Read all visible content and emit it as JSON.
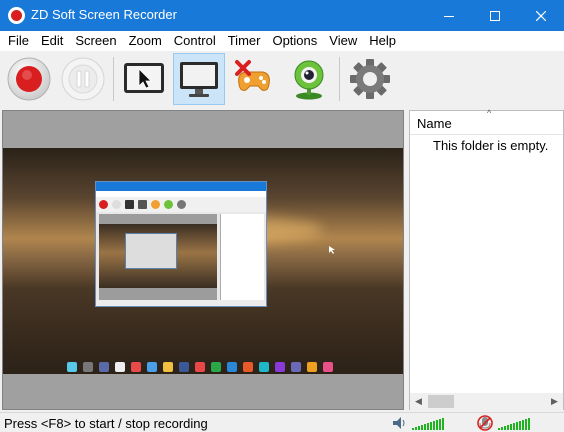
{
  "window": {
    "title": "ZD Soft Screen Recorder"
  },
  "menu": {
    "items": [
      "File",
      "Edit",
      "Screen",
      "Zoom",
      "Control",
      "Timer",
      "Options",
      "View",
      "Help"
    ]
  },
  "toolbar": {
    "buttons": [
      {
        "name": "record",
        "icon": "record-icon",
        "active": false
      },
      {
        "name": "pause",
        "icon": "pause-icon",
        "active": false
      },
      {
        "name": "select-region",
        "icon": "cursor-region-icon",
        "active": false
      },
      {
        "name": "full-screen",
        "icon": "monitor-icon",
        "active": true
      },
      {
        "name": "game-mode",
        "icon": "gamepad-icon",
        "active": false
      },
      {
        "name": "webcam",
        "icon": "webcam-icon",
        "active": false
      },
      {
        "name": "settings",
        "icon": "gear-icon",
        "active": false
      }
    ]
  },
  "file_panel": {
    "column_name": "Name",
    "empty_text": "This folder is empty."
  },
  "status": {
    "text": "Press <F8> to start / stop recording"
  },
  "colors": {
    "titlebar": "#1979d9",
    "record_red": "#d81e1e",
    "active_button": "#cce4f7",
    "meter_green": "#1fb31f"
  }
}
